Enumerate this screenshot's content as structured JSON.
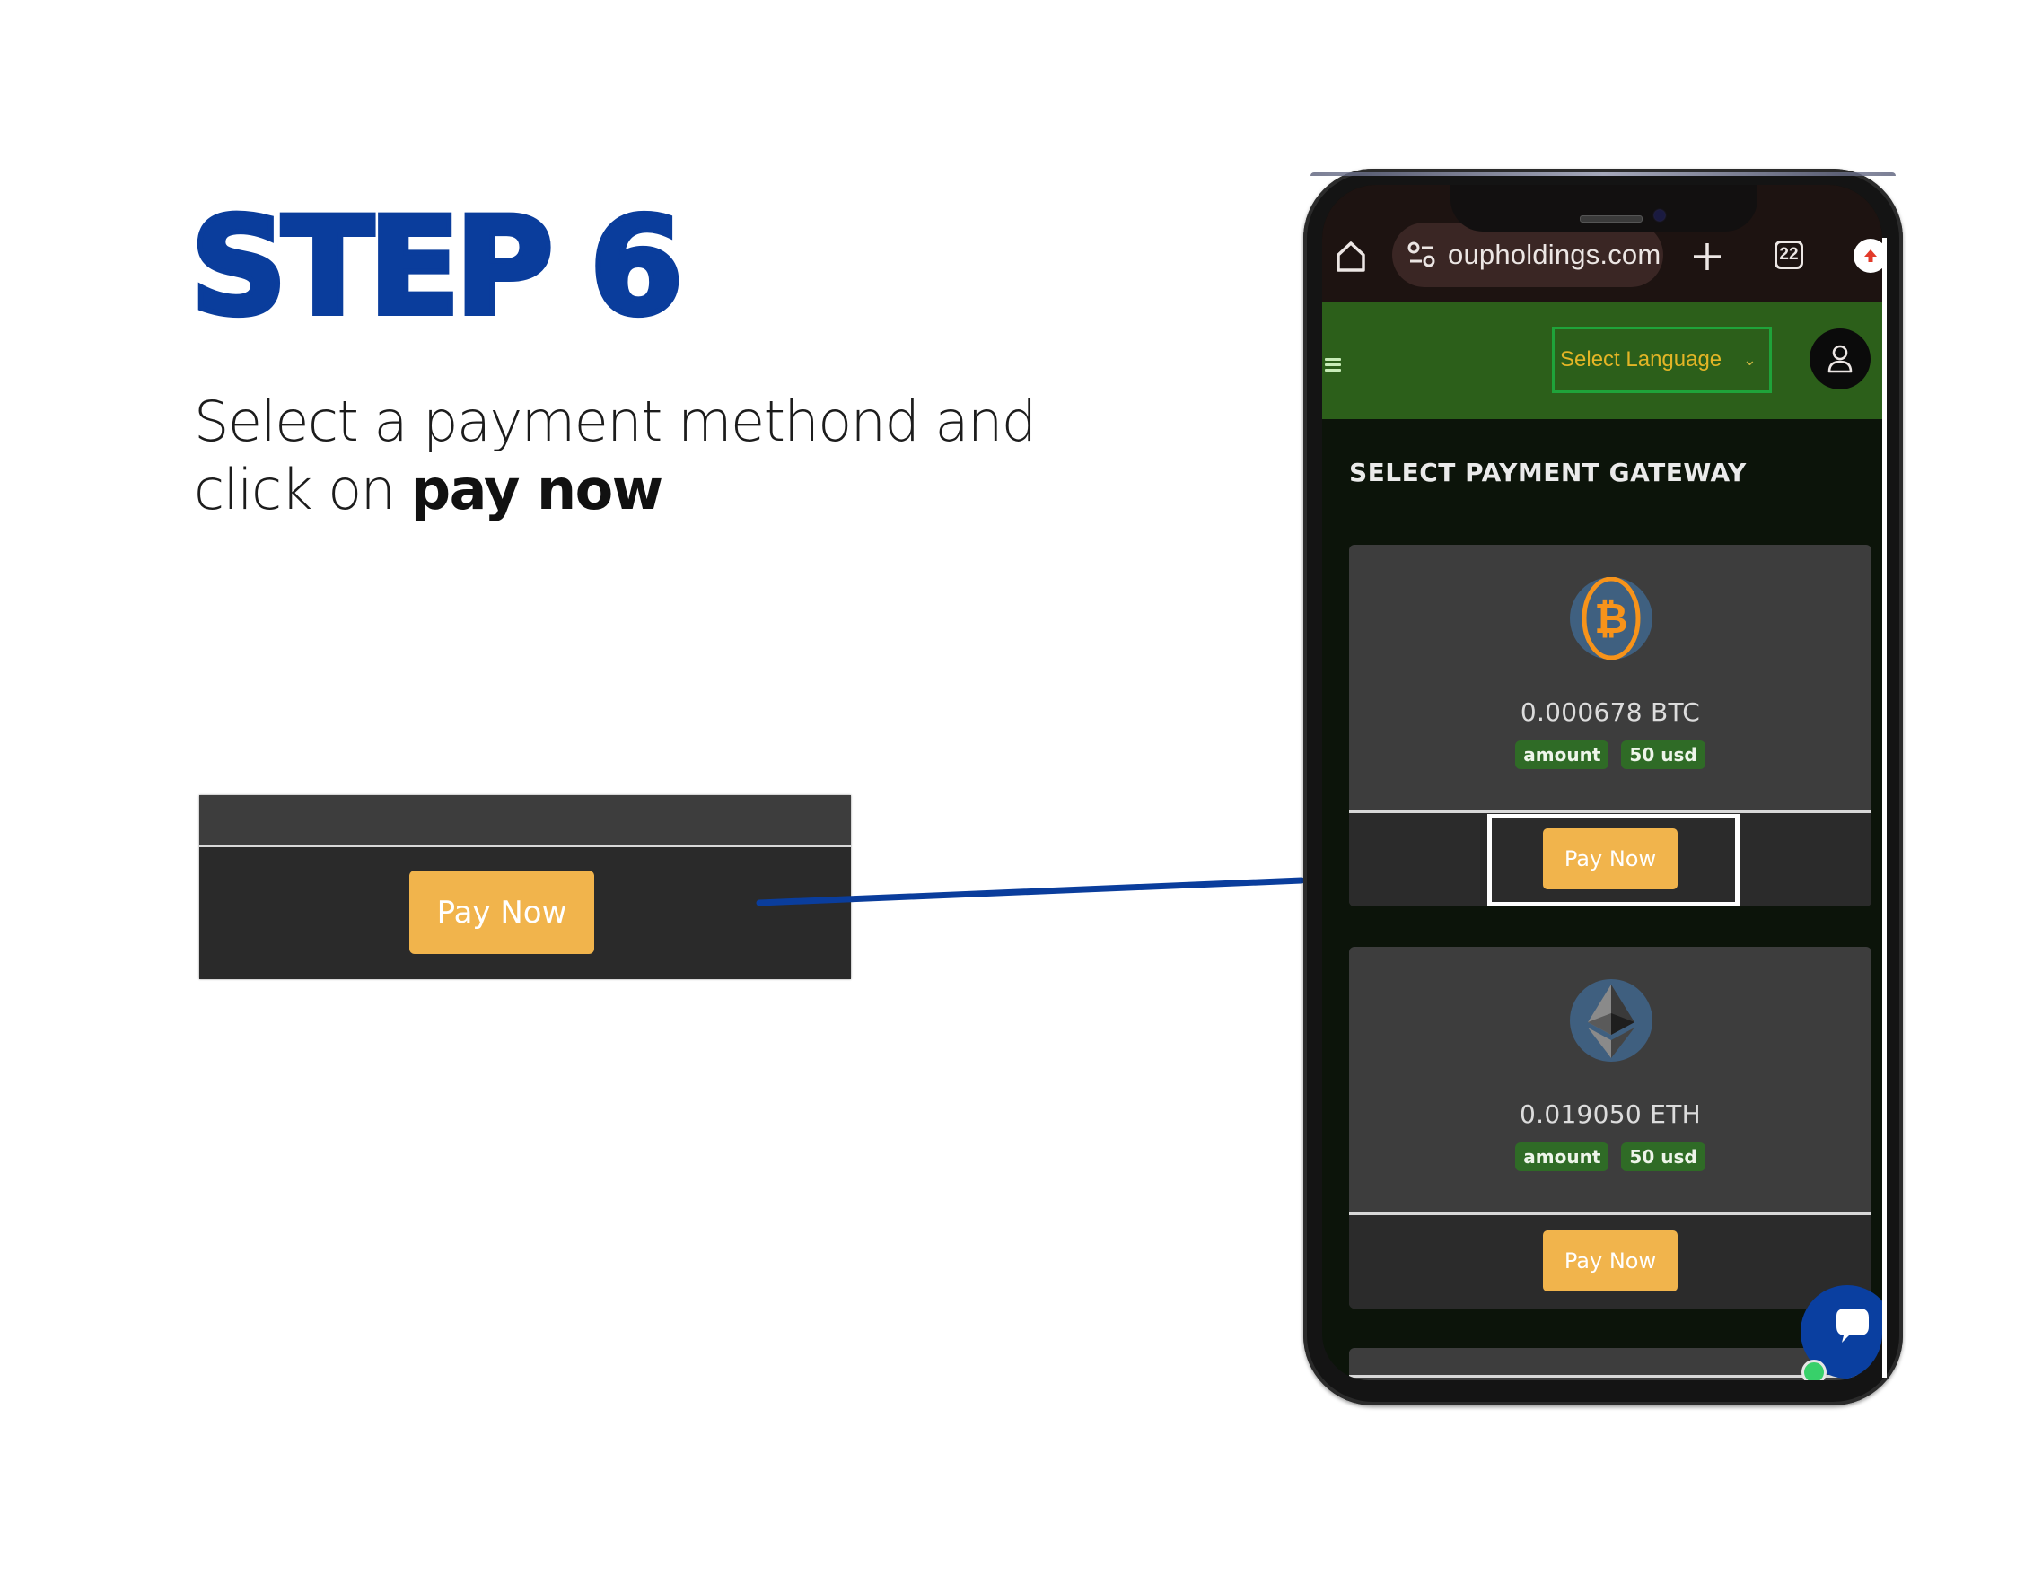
{
  "instructions": {
    "step_title": "STEP 6",
    "description_prefix": "Select a payment methond and click on ",
    "description_bold": "pay now"
  },
  "callout": {
    "button_label": "Pay Now"
  },
  "browser": {
    "url": "oupholdings.com",
    "tab_count": "22",
    "icons": [
      "home-icon",
      "site-settings-icon",
      "new-tab-plus-icon",
      "tab-switcher-icon",
      "update-icon"
    ]
  },
  "site_header": {
    "language_select": "Select Language",
    "icons": [
      "hamburger-menu-icon",
      "user-avatar-icon"
    ]
  },
  "page": {
    "title": "SELECT PAYMENT GATEWAY",
    "gateways": [
      {
        "coin": "BTC",
        "icon": "bitcoin-icon",
        "amount": "0.000678 BTC",
        "tag_label": "amount",
        "tag_value": "50 usd",
        "button_label": "Pay Now",
        "highlighted": true
      },
      {
        "coin": "ETH",
        "icon": "ethereum-icon",
        "amount": "0.019050 ETH",
        "tag_label": "amount",
        "tag_value": "50 usd",
        "button_label": "Pay Now",
        "highlighted": false
      }
    ]
  },
  "colors": {
    "brand_blue": "#0a3d9c",
    "button_orange": "#f1b44c",
    "header_green": "#2c5f1a",
    "tag_green": "#2f6b26",
    "language_text": "#e3b526"
  }
}
